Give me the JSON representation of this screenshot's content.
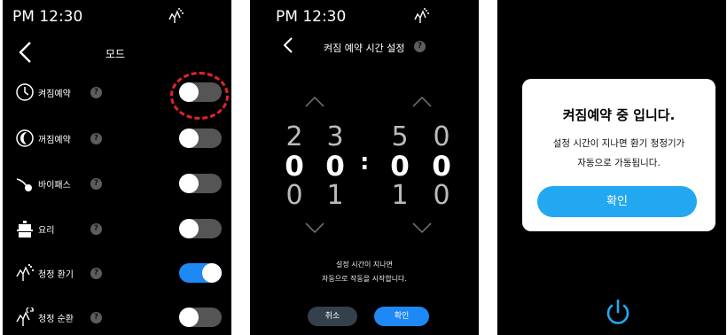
{
  "status": {
    "time": "PM 12:30",
    "icon": "air-purify-icon"
  },
  "mode_screen": {
    "title": "모드",
    "help_glyph": "?",
    "rows": [
      {
        "label": "켜짐예약",
        "icon": "clock-icon",
        "on": false
      },
      {
        "label": "꺼짐예약",
        "icon": "moon-icon",
        "on": false
      },
      {
        "label": "바이패스",
        "icon": "bypass-icon",
        "on": false
      },
      {
        "label": "요리",
        "icon": "cooking-pot-icon",
        "on": false
      },
      {
        "label": "청정 환기",
        "icon": "purify-ventilation-icon",
        "on": true
      },
      {
        "label": "청정 순환",
        "icon": "purify-circulation-icon",
        "on": false
      }
    ]
  },
  "timer_screen": {
    "title": "켜짐 예약 시간 설정",
    "hours": {
      "above": [
        "2",
        "3"
      ],
      "selected": [
        "0",
        "0"
      ],
      "below": [
        "0",
        "1"
      ]
    },
    "minutes": {
      "above": [
        "5",
        "0"
      ],
      "selected": [
        "0",
        "0"
      ],
      "below": [
        "1",
        "0"
      ]
    },
    "separator": ":",
    "info_line1": "설정 시간이 지나면",
    "info_line2": "자동으로 작동을 시작합니다.",
    "cancel_label": "취소",
    "ok_label": "확인"
  },
  "dialog_screen": {
    "title": "켜짐예약 중 입니다.",
    "message_line1": "설정 시간이 지나면 환기 청정기가",
    "message_line2": "자동으로 가동됩니다.",
    "ok_label": "확인",
    "icon": "power-icon"
  },
  "colors": {
    "accent": "#1e88f5",
    "dialog_button": "#22a8f0",
    "highlight_ring": "#e0242a",
    "toggle_off": "#555555"
  }
}
